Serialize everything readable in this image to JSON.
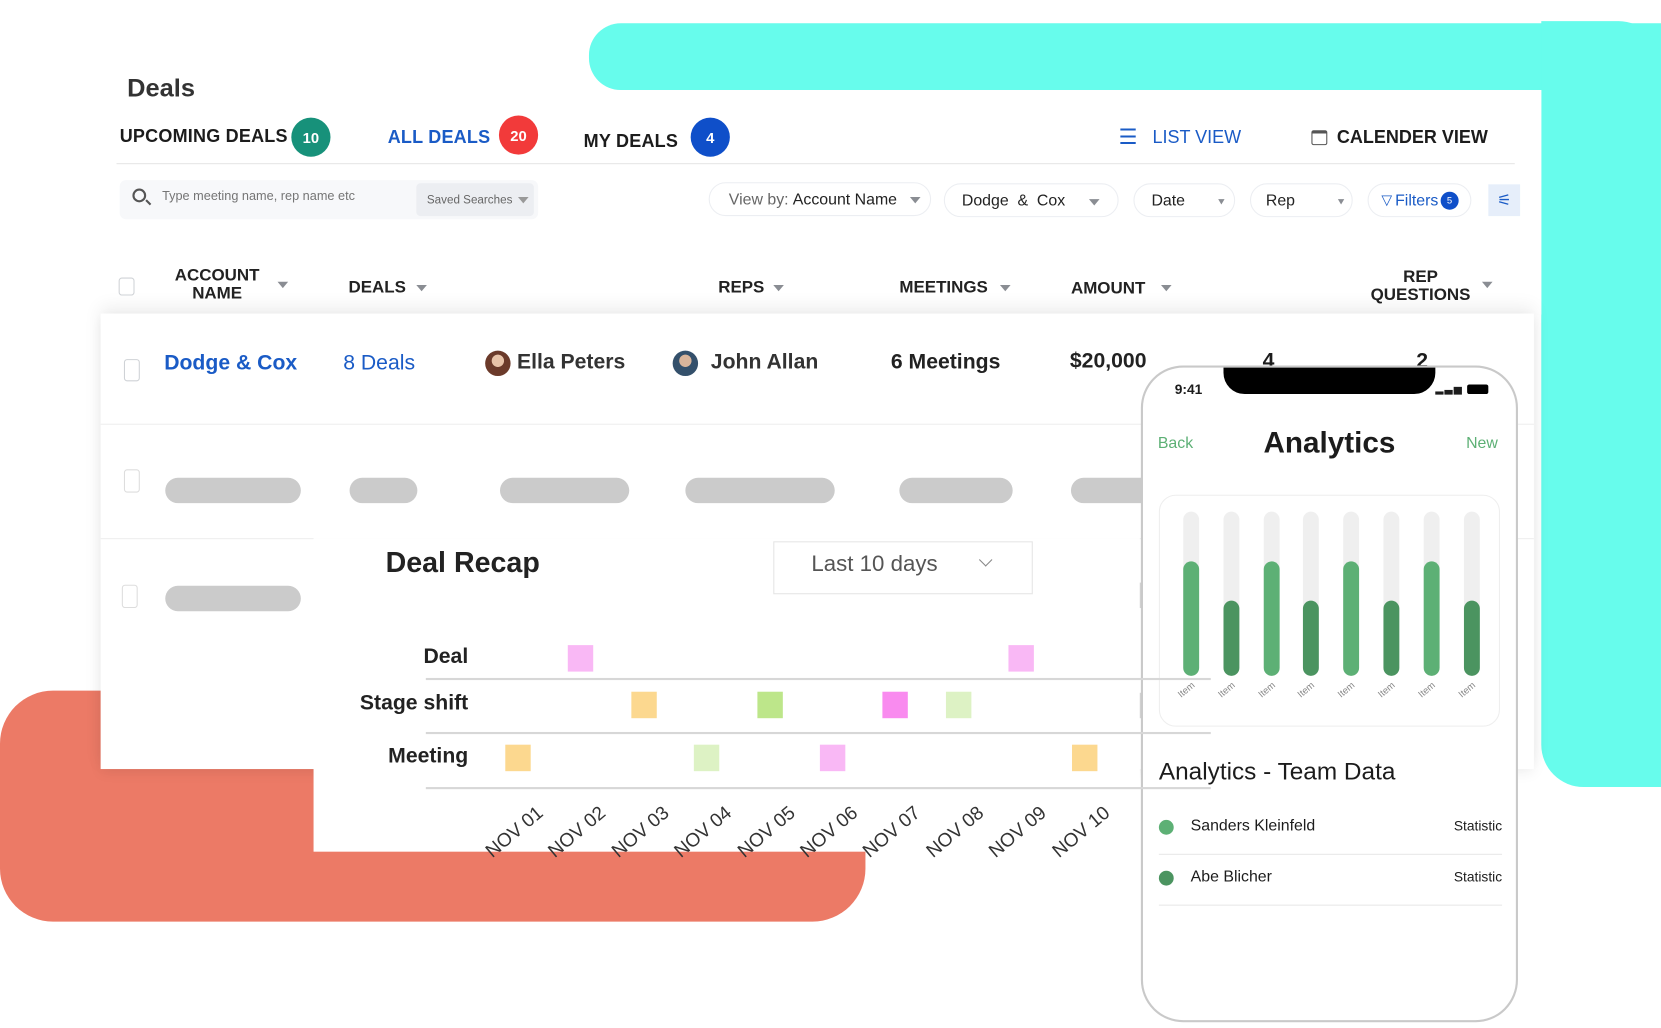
{
  "colors": {
    "teal_shape": "#67FCEC",
    "salmon_shape": "#EC7A66",
    "accent_blue": "#1A5BC6",
    "phone_green_light": "#5DB075",
    "phone_green_dark": "#4B9460"
  },
  "page": {
    "title": "Deals"
  },
  "tabs": [
    {
      "label": "UPCOMING DEALS",
      "count": "10",
      "color": "#17917A"
    },
    {
      "label": "ALL DEALS",
      "count": "20",
      "color": "#F23A3A",
      "active": true
    },
    {
      "label": "MY DEALS",
      "count": "4",
      "color": "#0F4FC9"
    }
  ],
  "views": {
    "list": "LIST VIEW",
    "calendar": "CALENDER VIEW",
    "list_icon": "list-icon",
    "calendar_icon": "calendar-icon"
  },
  "search": {
    "placeholder": "Type meeting name, rep name etc",
    "saved": "Saved Searches"
  },
  "filters": {
    "view_by_label": "View by:",
    "view_by_value": "Account Name",
    "account": "Dodge  &  Cox",
    "date": "Date",
    "rep": "Rep",
    "filters_label": "Filters",
    "filters_count": "5"
  },
  "table": {
    "headers": [
      {
        "line1": "ACCOUNT",
        "line2": "NAME"
      },
      {
        "line1": "DEALS"
      },
      {
        "line1": "REPS"
      },
      {
        "line1": "MEETINGS"
      },
      {
        "line1": "AMOUNT"
      },
      {
        "line1": "REP",
        "line2": "QUESTIONS"
      }
    ],
    "row": {
      "account": "Dodge & Cox",
      "deals": "8 Deals",
      "rep1": "Ella Peters",
      "rep2": "John Allan",
      "meetings": "6 Meetings",
      "amount": "$20,000",
      "col7": "4",
      "col8": "2"
    }
  },
  "recap": {
    "title": "Deal Recap",
    "range": "Last 10 days"
  },
  "chart_data": {
    "type": "scatter",
    "categories": [
      "NOV 01",
      "NOV 02",
      "NOV 03",
      "NOV 04",
      "NOV 05",
      "NOV 06",
      "NOV 07",
      "NOV 08",
      "NOV 09",
      "NOV 10"
    ],
    "rows": [
      "Deal",
      "Stage shift",
      "Meeting"
    ],
    "events": [
      {
        "row": "Deal",
        "date": "NOV 02",
        "color": "#F9B8F5"
      },
      {
        "row": "Deal",
        "date": "NOV 09",
        "color": "#F9B8F5"
      },
      {
        "row": "Stage shift",
        "date": "NOV 03",
        "color": "#FCD88F"
      },
      {
        "row": "Stage shift",
        "date": "NOV 05",
        "color": "#BDE68A"
      },
      {
        "row": "Stage shift",
        "date": "NOV 07",
        "color": "#F98BEF"
      },
      {
        "row": "Stage shift",
        "date": "NOV 08",
        "color": "#DDF2C4"
      },
      {
        "row": "Meeting",
        "date": "NOV 01",
        "color": "#FCD88F"
      },
      {
        "row": "Meeting",
        "date": "NOV 04",
        "color": "#DDF2C4"
      },
      {
        "row": "Meeting",
        "date": "NOV 06",
        "color": "#F9B8F5"
      },
      {
        "row": "Meeting",
        "date": "NOV 10",
        "color": "#FCD88F"
      }
    ],
    "grid": true
  },
  "phone": {
    "time": "9:41",
    "back": "Back",
    "title": "Analytics",
    "new": "New",
    "bars": {
      "labels": [
        "Item",
        "Item",
        "Item",
        "Item",
        "Item",
        "Item",
        "Item",
        "Item"
      ],
      "values": [
        0.7,
        0.46,
        0.7,
        0.46,
        0.7,
        0.46,
        0.7,
        0.46
      ]
    },
    "section": "Analytics - Team Data",
    "list": [
      {
        "name": "Sanders Kleinfeld",
        "value": "Statistic",
        "color": "#5DB075"
      },
      {
        "name": "Abe Blicher",
        "value": "Statistic",
        "color": "#4B9460"
      }
    ]
  }
}
